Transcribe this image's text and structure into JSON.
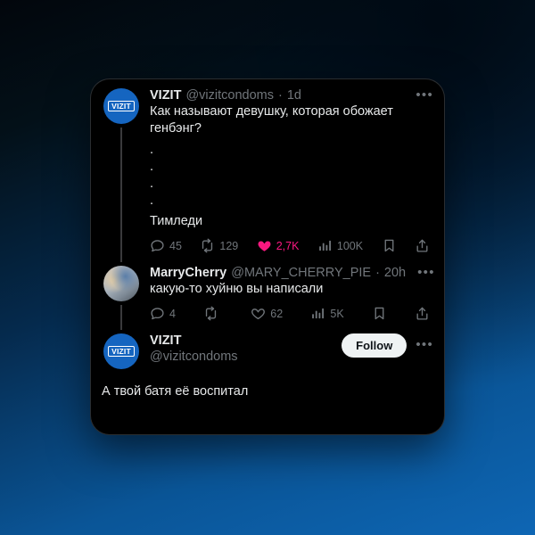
{
  "theme": {
    "card_bg": "#000000",
    "text_primary": "#e7e9ea",
    "text_secondary": "#71767b",
    "accent_like": "#f91880",
    "brand_blue": "#1565c0",
    "follow_bg": "#eff3f4"
  },
  "tweets": [
    {
      "display_name": "VIZIT",
      "handle": "@vizitcondoms",
      "separator": "·",
      "timestamp": "1d",
      "avatar_label": "VIZIT",
      "text": "Как называют девушку, которая обожает генбэнг?",
      "dot_lines": [
        ".",
        ".",
        ".",
        "."
      ],
      "closing_text": "Тимледи",
      "more_glyph": "•••",
      "actions": {
        "reply_label": "45",
        "retweet_label": "129",
        "like_label": "2,7K",
        "views_label": "100K",
        "liked": true
      }
    },
    {
      "display_name": "MarryCherry",
      "handle": "@MARY_CHERRY_PIE",
      "separator": "·",
      "timestamp": "20h",
      "text": "какую-то хуйню вы написали",
      "more_glyph": "•••",
      "actions": {
        "reply_label": "4",
        "retweet_label": "",
        "like_label": "62",
        "views_label": "5K",
        "liked": false
      }
    }
  ],
  "profile_row": {
    "display_name": "VIZIT",
    "handle": "@vizitcondoms",
    "avatar_label": "VIZIT",
    "follow_label": "Follow",
    "more_glyph": "•••"
  },
  "bottom_message": {
    "text": "А твой батя её воспитал"
  },
  "icons": {
    "reply": "reply-icon",
    "retweet": "retweet-icon",
    "like": "heart-icon",
    "views": "views-bar-icon",
    "bookmark": "bookmark-icon",
    "share": "share-icon",
    "more": "more-options-icon"
  }
}
